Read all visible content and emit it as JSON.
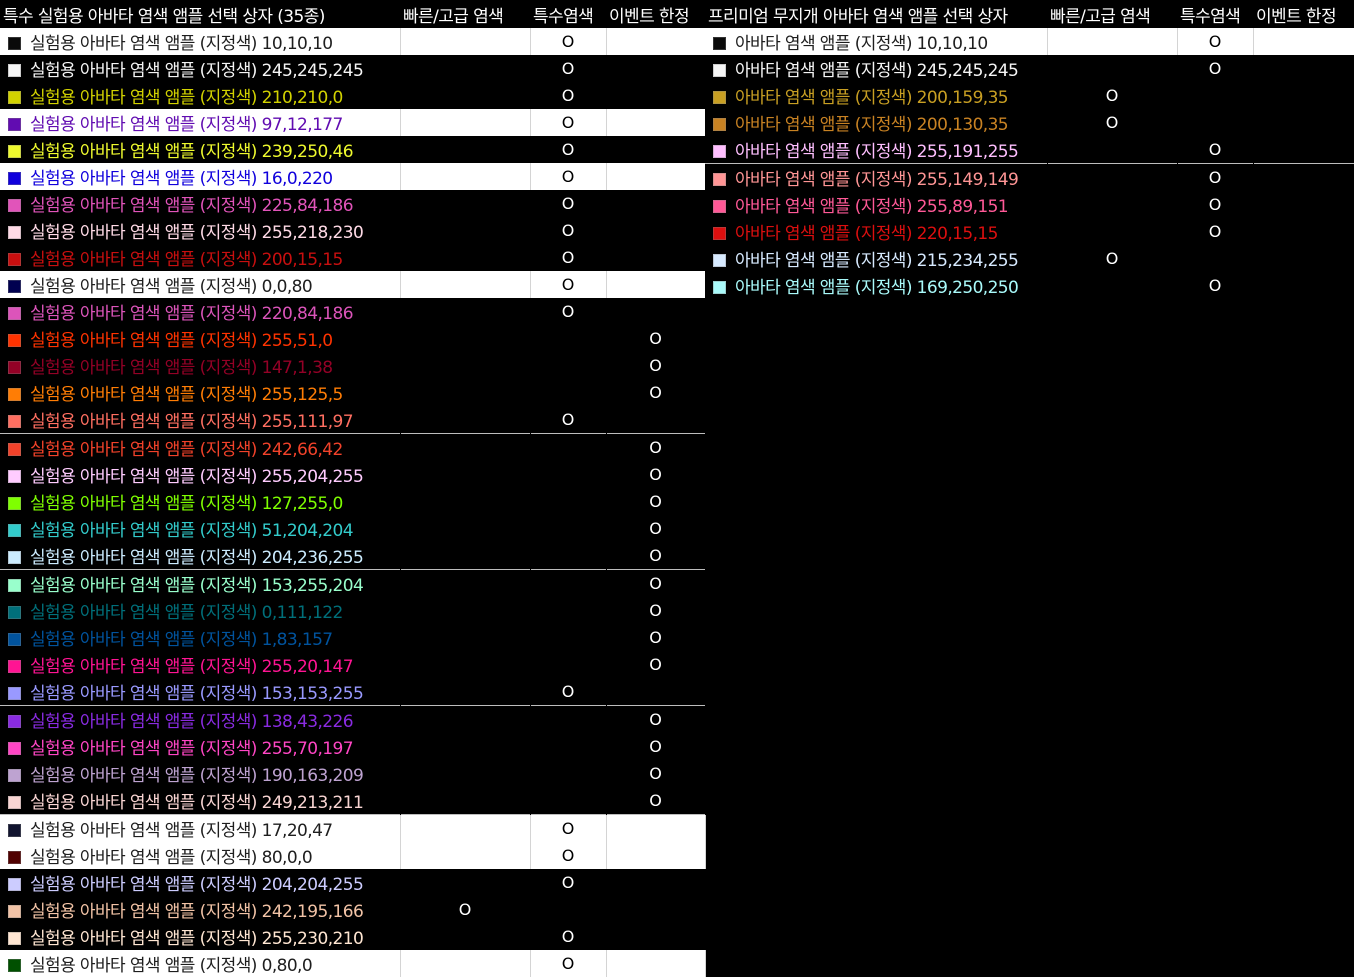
{
  "left": {
    "headers": [
      "특수 실험용 아바타 염색 앰플 선택 상자 (35종)",
      "빠른/고급 염색",
      "특수염색",
      "이벤트 한정"
    ],
    "rows": [
      {
        "name": "실험용 아바타 염색 앰플 (지정색) 10,10,10",
        "color": "#0a0a0a",
        "text_color": "#1e1e1e",
        "bg": "light",
        "fast": "",
        "special": "O",
        "event": "",
        "sep": false
      },
      {
        "name": "실험용 아바타 염색 앰플 (지정색) 245,245,245",
        "color": "#f5f5f5",
        "text_color": "#f5f5f5",
        "bg": "dark",
        "fast": "",
        "special": "O",
        "event": "",
        "sep": false
      },
      {
        "name": "실험용 아바타 염색 앰플 (지정색) 210,210,0",
        "color": "#d2d200",
        "text_color": "#d2d200",
        "bg": "dark",
        "fast": "",
        "special": "O",
        "event": "",
        "sep": false
      },
      {
        "name": "실험용 아바타 염색 앰플 (지정색) 97,12,177",
        "color": "#610cb1",
        "text_color": "#610cb1",
        "bg": "light",
        "fast": "",
        "special": "O",
        "event": "",
        "sep": false
      },
      {
        "name": "실험용 아바타 염색 앰플 (지정색) 239,250,46",
        "color": "#effa2e",
        "text_color": "#effa2e",
        "bg": "dark",
        "fast": "",
        "special": "O",
        "event": "",
        "sep": false
      },
      {
        "name": "실험용 아바타 염색 앰플 (지정색) 16,0,220",
        "color": "#1000dc",
        "text_color": "#1000dc",
        "bg": "light",
        "fast": "",
        "special": "O",
        "event": "",
        "sep": false
      },
      {
        "name": "실험용 아바타 염색 앰플 (지정색) 225,84,186",
        "color": "#e154ba",
        "text_color": "#e154ba",
        "bg": "dark",
        "fast": "",
        "special": "O",
        "event": "",
        "sep": false
      },
      {
        "name": "실험용 아바타 염색 앰플 (지정색) 255,218,230",
        "color": "#ffdae6",
        "text_color": "#ffdae6",
        "bg": "dark",
        "fast": "",
        "special": "O",
        "event": "",
        "sep": false
      },
      {
        "name": "실험용 아바타 염색 앰플 (지정색) 200,15,15",
        "color": "#c80f0f",
        "text_color": "#c80f0f",
        "bg": "dark",
        "fast": "",
        "special": "O",
        "event": "",
        "sep": false
      },
      {
        "name": "실험용 아바타 염색 앰플 (지정색) 0,0,80",
        "color": "#000050",
        "text_color": "#1e1e1e",
        "bg": "light",
        "fast": "",
        "special": "O",
        "event": "",
        "sep": false
      },
      {
        "name": "실험용 아바타 염색 앰플 (지정색) 220,84,186",
        "color": "#dc54ba",
        "text_color": "#dc54ba",
        "bg": "dark",
        "fast": "",
        "special": "O",
        "event": "",
        "sep": false
      },
      {
        "name": "실험용 아바타 염색 앰플 (지정색) 255,51,0",
        "color": "#ff3300",
        "text_color": "#ff3300",
        "bg": "dark",
        "fast": "",
        "special": "",
        "event": "O",
        "sep": false
      },
      {
        "name": "실험용 아바타 염색 앰플 (지정색) 147,1,38",
        "color": "#930126",
        "text_color": "#930126",
        "bg": "dark",
        "fast": "",
        "special": "",
        "event": "O",
        "sep": false
      },
      {
        "name": "실험용 아바타 염색 앰플 (지정색) 255,125,5",
        "color": "#ff7d05",
        "text_color": "#ff7d05",
        "bg": "dark",
        "fast": "",
        "special": "",
        "event": "O",
        "sep": false
      },
      {
        "name": "실험용 아바타 염색 앰플 (지정색) 255,111,97",
        "color": "#ff6f61",
        "text_color": "#ff6f61",
        "bg": "dark",
        "fast": "",
        "special": "O",
        "event": "",
        "sep": false
      },
      {
        "name": "실험용 아바타 염색 앰플 (지정색) 242,66,42",
        "color": "#f2422a",
        "text_color": "#f2422a",
        "bg": "dark",
        "fast": "",
        "special": "",
        "event": "O",
        "sep": true
      },
      {
        "name": "실험용 아바타 염색 앰플 (지정색) 255,204,255",
        "color": "#ffccff",
        "text_color": "#ffccff",
        "bg": "dark",
        "fast": "",
        "special": "",
        "event": "O",
        "sep": false
      },
      {
        "name": "실험용 아바타 염색 앰플 (지정색) 127,255,0",
        "color": "#7fff00",
        "text_color": "#7fff00",
        "bg": "dark",
        "fast": "",
        "special": "",
        "event": "O",
        "sep": false
      },
      {
        "name": "실험용 아바타 염색 앰플 (지정색) 51,204,204",
        "color": "#33cccc",
        "text_color": "#33cccc",
        "bg": "dark",
        "fast": "",
        "special": "",
        "event": "O",
        "sep": false
      },
      {
        "name": "실험용 아바타 염색 앰플 (지정색) 204,236,255",
        "color": "#ccecff",
        "text_color": "#ccecff",
        "bg": "dark",
        "fast": "",
        "special": "",
        "event": "O",
        "sep": false
      },
      {
        "name": "실험용 아바타 염색 앰플 (지정색) 153,255,204",
        "color": "#99ffcc",
        "text_color": "#99ffcc",
        "bg": "dark",
        "fast": "",
        "special": "",
        "event": "O",
        "sep": true
      },
      {
        "name": "실험용 아바타 염색 앰플 (지정색) 0,111,122",
        "color": "#006f7a",
        "text_color": "#006f7a",
        "bg": "dark",
        "fast": "",
        "special": "",
        "event": "O",
        "sep": false
      },
      {
        "name": "실험용 아바타 염색 앰플 (지정색) 1,83,157",
        "color": "#01539d",
        "text_color": "#01539d",
        "bg": "dark",
        "fast": "",
        "special": "",
        "event": "O",
        "sep": false
      },
      {
        "name": "실험용 아바타 염색 앰플 (지정색) 255,20,147",
        "color": "#ff1493",
        "text_color": "#ff1493",
        "bg": "dark",
        "fast": "",
        "special": "",
        "event": "O",
        "sep": false
      },
      {
        "name": "실험용 아바타 염색 앰플 (지정색) 153,153,255",
        "color": "#9999ff",
        "text_color": "#9999ff",
        "bg": "dark",
        "fast": "",
        "special": "O",
        "event": "",
        "sep": false
      },
      {
        "name": "실험용 아바타 염색 앰플 (지정색) 138,43,226",
        "color": "#8a2be2",
        "text_color": "#8a2be2",
        "bg": "dark",
        "fast": "",
        "special": "",
        "event": "O",
        "sep": true
      },
      {
        "name": "실험용 아바타 염색 앰플 (지정색) 255,70,197",
        "color": "#ff46c5",
        "text_color": "#ff46c5",
        "bg": "dark",
        "fast": "",
        "special": "",
        "event": "O",
        "sep": false
      },
      {
        "name": "실험용 아바타 염색 앰플 (지정색) 190,163,209",
        "color": "#bea3d1",
        "text_color": "#bea3d1",
        "bg": "dark",
        "fast": "",
        "special": "",
        "event": "O",
        "sep": false
      },
      {
        "name": "실험용 아바타 염색 앰플 (지정색) 249,213,211",
        "color": "#f9d5d3",
        "text_color": "#f9d5d3",
        "bg": "dark",
        "fast": "",
        "special": "",
        "event": "O",
        "sep": false
      },
      {
        "name": "실험용 아바타 염색 앰플 (지정색) 17,20,47",
        "color": "#11142f",
        "text_color": "#1e1e1e",
        "bg": "light",
        "fast": "",
        "special": "O",
        "event": "",
        "sep": true
      },
      {
        "name": "실험용 아바타 염색 앰플 (지정색) 80,0,0",
        "color": "#500000",
        "text_color": "#1e1e1e",
        "bg": "light",
        "fast": "",
        "special": "O",
        "event": "",
        "sep": false
      },
      {
        "name": "실험용 아바타 염색 앰플 (지정색) 204,204,255",
        "color": "#ccccff",
        "text_color": "#ccccff",
        "bg": "dark",
        "fast": "",
        "special": "O",
        "event": "",
        "sep": false
      },
      {
        "name": "실험용 아바타 염색 앰플 (지정색) 242,195,166",
        "color": "#f2c3a6",
        "text_color": "#f2c3a6",
        "bg": "dark",
        "fast": "O",
        "special": "",
        "event": "",
        "sep": false
      },
      {
        "name": "실험용 아바타 염색 앰플 (지정색) 255,230,210",
        "color": "#ffe6d2",
        "text_color": "#ffe6d2",
        "bg": "dark",
        "fast": "",
        "special": "O",
        "event": "",
        "sep": false
      },
      {
        "name": "실험용 아바타 염색 앰플 (지정색) 0,80,0",
        "color": "#005000",
        "text_color": "#1e1e1e",
        "bg": "light",
        "fast": "",
        "special": "O",
        "event": "",
        "sep": false
      }
    ]
  },
  "right": {
    "headers": [
      "프리미엄 무지개 아바타 염색 앰플 선택 상자",
      "빠른/고급 염색",
      "특수염색",
      "이벤트 한정"
    ],
    "rows": [
      {
        "name": "아바타 염색 앰플 (지정색) 10,10,10",
        "color": "#0a0a0a",
        "text_color": "#1e1e1e",
        "bg": "light",
        "fast": "",
        "special": "O",
        "event": "",
        "sep": false
      },
      {
        "name": "아바타 염색 앰플 (지정색) 245,245,245",
        "color": "#f5f5f5",
        "text_color": "#f5f5f5",
        "bg": "dark",
        "fast": "",
        "special": "O",
        "event": "",
        "sep": false
      },
      {
        "name": "아바타 염색 앰플 (지정색) 200,159,35",
        "color": "#c89f23",
        "text_color": "#c89f23",
        "bg": "dark",
        "fast": "O",
        "special": "",
        "event": "",
        "sep": false
      },
      {
        "name": "아바타 염색 앰플 (지정색) 200,130,35",
        "color": "#c88223",
        "text_color": "#c88223",
        "bg": "dark",
        "fast": "O",
        "special": "",
        "event": "",
        "sep": false
      },
      {
        "name": "아바타 염색 앰플 (지정색) 255,191,255",
        "color": "#ffbfff",
        "text_color": "#ffbfff",
        "bg": "dark",
        "fast": "",
        "special": "O",
        "event": "",
        "sep": false
      },
      {
        "name": "아바타 염색 앰플 (지정색) 255,149,149",
        "color": "#ff9595",
        "text_color": "#ff9595",
        "bg": "dark",
        "fast": "",
        "special": "O",
        "event": "",
        "sep": true
      },
      {
        "name": "아바타 염색 앰플 (지정색) 255,89,151",
        "color": "#ff5997",
        "text_color": "#ff5997",
        "bg": "dark",
        "fast": "",
        "special": "O",
        "event": "",
        "sep": false
      },
      {
        "name": "아바타 염색 앰플 (지정색) 220,15,15",
        "color": "#dc0f0f",
        "text_color": "#dc0f0f",
        "bg": "dark",
        "fast": "",
        "special": "O",
        "event": "",
        "sep": false
      },
      {
        "name": "아바타 염색 앰플 (지정색) 215,234,255",
        "color": "#d7eaff",
        "text_color": "#d7eaff",
        "bg": "dark",
        "fast": "O",
        "special": "",
        "event": "",
        "sep": false
      },
      {
        "name": "아바타 염색 앰플 (지정색) 169,250,250",
        "color": "#a9fafa",
        "text_color": "#a9fafa",
        "bg": "dark",
        "fast": "",
        "special": "O",
        "event": "",
        "sep": false
      }
    ]
  }
}
